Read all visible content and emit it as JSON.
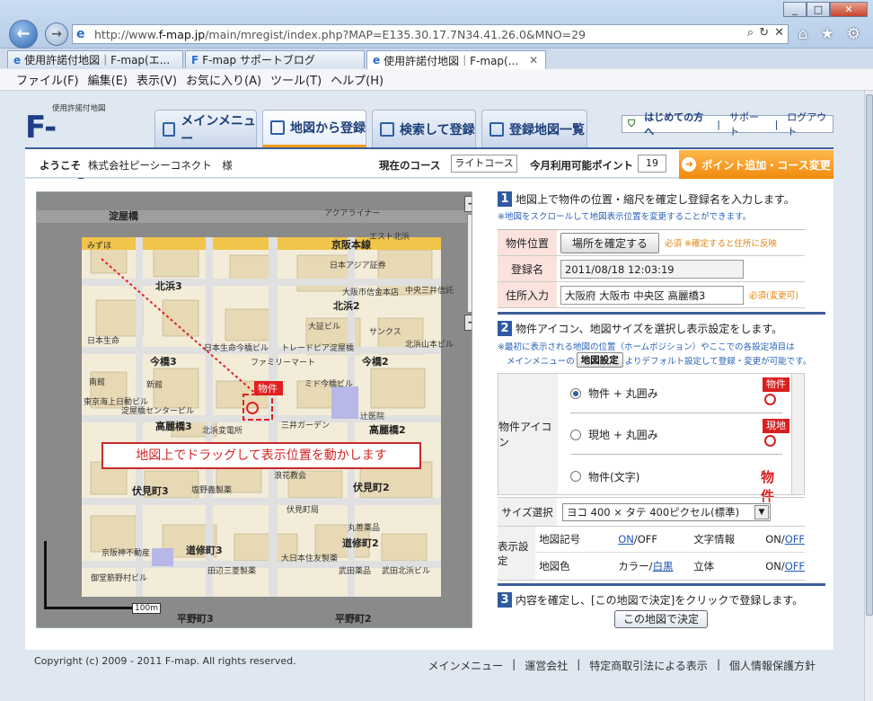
{
  "browser": {
    "url_prefix": "http://www.",
    "url_domain": "f-map.jp",
    "url_rest": "/main/mregist/index.php?MAP=E135.30.17.7N34.41.26.0&MNO=29",
    "tabs": [
      {
        "label": "使用許諾付地図｜F-map(エ..."
      },
      {
        "label": "F-map サポートブログ"
      },
      {
        "label": "使用許諾付地図｜F-map(..."
      }
    ],
    "menu": [
      "ファイル(F)",
      "編集(E)",
      "表示(V)",
      "お気に入り(A)",
      "ツール(T)",
      "ヘルプ(H)"
    ]
  },
  "site": {
    "logo_small": "使用許諾付地図",
    "logo_big": "F-map",
    "nav": [
      "メインメニュー",
      "地図から登録",
      "検索して登録",
      "登録地図一覧"
    ],
    "top_links": [
      "はじめての方へ",
      "サポート",
      "ログアウト"
    ],
    "welcome_label": "ようこそ",
    "company": "株式会社ピーシーコネクト　様",
    "course_label": "現在のコース",
    "course_value": "ライトコース",
    "points_label": "今月利用可能ポイント",
    "points_value": "19",
    "add_button": "ポイント追加・コース変更"
  },
  "map": {
    "drag_message": "地図上でドラッグして表示位置を動かします",
    "pin_label": "物件",
    "scale_label": "100m",
    "zoom_in": "+",
    "zoom_out": "−",
    "labels": [
      "淀屋橋",
      "京阪本線",
      "北浜2",
      "北浜3",
      "北浜2",
      "今橋3",
      "今橋2",
      "高麗橋3",
      "高麗橋2",
      "伏見町3",
      "伏見町2",
      "道修町3",
      "道修町2",
      "平野町3",
      "平野町2",
      "みずほ",
      "日本生命",
      "南館",
      "新館",
      "三井ガーデン",
      "浪花教会",
      "丸善薬品",
      "武田薬品",
      "武田北浜ビル",
      "大証ビル",
      "サンクス",
      "淀屋橋センタービル",
      "ミド今橋ビル",
      "日本アジア証券",
      "大阪市信金本店",
      "中央三井信託",
      "日本生命今橋ビル",
      "トレードピア淀屋橋",
      "ファミリーマート",
      "北浜変電所",
      "辻医院",
      "塩野義製薬",
      "伏見町局",
      "大日本住友製薬",
      "田辺三菱製薬",
      "京阪神不動産",
      "御堂筋野村ビル",
      "東京海上日動ビル",
      "北浜山本ビル",
      "アクアライナー",
      "エスト北浜"
    ]
  },
  "panel": {
    "step1": "地図上で物件の位置・縮尺を確定し登録名を入力します。",
    "step1_note": "※地図をスクロールして地図表示位置を変更することができます。",
    "row_location_label": "物件位置",
    "row_location_button": "場所を確定する",
    "row_location_req": "必須 ※確定すると住所に反映",
    "row_name_label": "登録名",
    "row_name_value": "2011/08/18 12:03:19",
    "row_addr_label": "住所入力",
    "row_addr_value": "大阪府 大阪市 中央区 高麗橋3",
    "row_addr_req": "必須(変更可)",
    "step2": "物件アイコン、地図サイズを選択し表示設定をします。",
    "step2_note1": "※最初に表示される地図の位置（ホームポジション）やここでの各設定項目は",
    "step2_note2a": "メインメニューの",
    "step2_note2_btn": "地図設定",
    "step2_note2b": "よりデフォルト設定して登録・変更が可能です。",
    "icon_label": "物件アイコン",
    "icon_options": [
      {
        "label": "物件 + 丸囲み",
        "badge": "物件"
      },
      {
        "label": "現地 + 丸囲み",
        "badge": "現地"
      },
      {
        "label": "物件(文字)",
        "badge": "物件"
      }
    ],
    "size_label": "サイズ選択",
    "size_value": "ヨコ 400 × タテ 400ピクセル(標準)",
    "display_label": "表示設定",
    "disp_symbol": "地図記号",
    "disp_symbol_on": "ON",
    "disp_symbol_off": "/OFF",
    "disp_text": "文字情報",
    "disp_text_on": "ON/",
    "disp_text_off": "OFF",
    "disp_color": "地図色",
    "disp_color_a": "カラー/",
    "disp_color_b": "白黒",
    "disp_3d": "立体",
    "disp_3d_on": "ON/",
    "disp_3d_off": "OFF",
    "step3": "内容を確定し、[この地図で決定]をクリックで登録します。",
    "confirm_button": "この地図で決定"
  },
  "footer": {
    "copyright": "Copyright (c) 2009 - 2011 F-map. All rights reserved.",
    "links": [
      "メインメニュー",
      "運営会社",
      "特定商取引法による表示",
      "個人情報保護方針"
    ]
  }
}
